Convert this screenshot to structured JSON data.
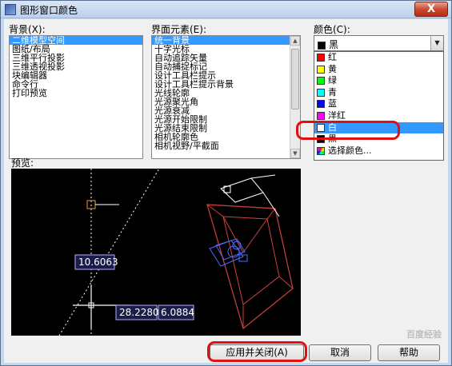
{
  "window": {
    "title": "图形窗口颜色",
    "close_glyph": "X"
  },
  "background": {
    "label": "背景(X):",
    "items": [
      "二维模型空间",
      "图纸/布局",
      "三维平行投影",
      "三维透视投影",
      "块编辑器",
      "命令行",
      "打印预览"
    ],
    "selected_index": 0
  },
  "elements": {
    "label": "界面元素(E):",
    "items": [
      "统一背景",
      "十字光标",
      "自动追踪矢量",
      "自动捕捉标记",
      "设计工具栏提示",
      "设计工具栏提示背景",
      "光线轮廓",
      "光源聚光角",
      "光源衰减",
      "光源开始限制",
      "光源结束限制",
      "相机轮廓色",
      "相机视野/平截面"
    ],
    "selected_index": 0
  },
  "color": {
    "label": "颜色(C):",
    "value": "黑",
    "value_color": "#000000",
    "options": [
      {
        "name": "红",
        "color": "#ff0000"
      },
      {
        "name": "黄",
        "color": "#ffff00"
      },
      {
        "name": "绿",
        "color": "#00ff00"
      },
      {
        "name": "青",
        "color": "#00ffff"
      },
      {
        "name": "蓝",
        "color": "#0000ff"
      },
      {
        "name": "洋红",
        "color": "#ff00ff"
      },
      {
        "name": "白",
        "color": "#ffffff"
      },
      {
        "name": "黑",
        "color": "#000000"
      },
      {
        "name": "选择颜色...",
        "color": "multicolor"
      }
    ],
    "selected_index": 6
  },
  "preview": {
    "label": "预览:",
    "dim_a": "10.6063",
    "dim_b": "28.2280",
    "dim_c": "6.0884"
  },
  "buttons": {
    "apply_close": "应用并关闭(A)",
    "cancel": "取消",
    "help": "帮助"
  },
  "watermark": "百度经验"
}
